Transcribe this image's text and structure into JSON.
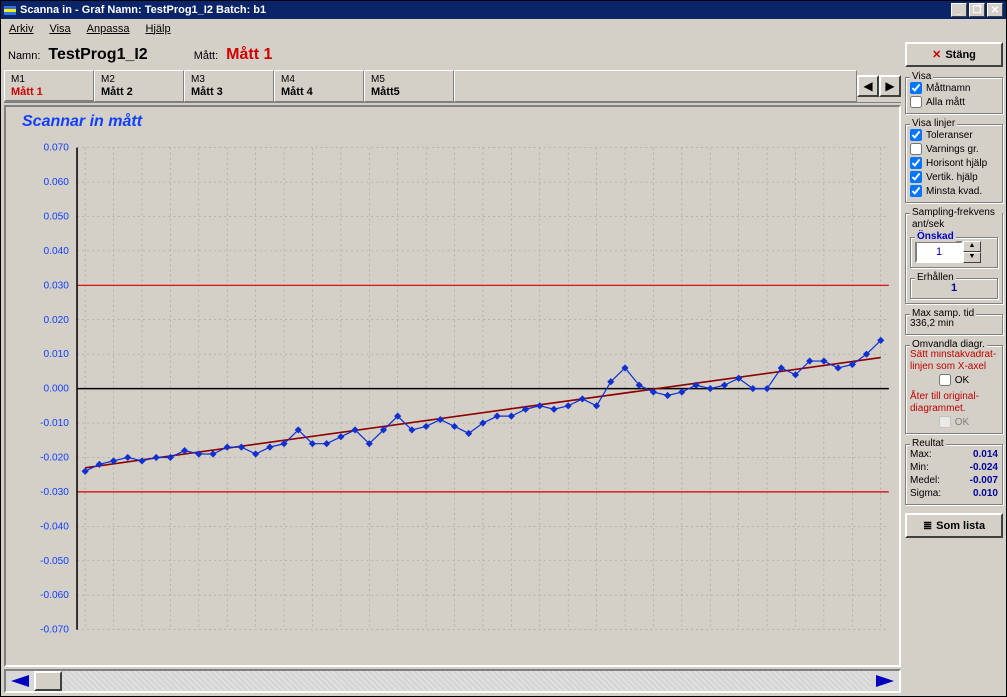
{
  "titlebar": "Scanna in - Graf   Namn: TestProg1_I2   Batch: b1",
  "menu": {
    "arkiv": "Arkiv",
    "visa": "Visa",
    "anpassa": "Anpassa",
    "hjalp": "Hjälp"
  },
  "header": {
    "namn_lbl": "Namn:",
    "namn": "TestProg1_I2",
    "matt_lbl": "Mått:",
    "matt": "Mått 1"
  },
  "tabs": [
    {
      "m": "M1",
      "name": "Mått 1",
      "active": true
    },
    {
      "m": "M2",
      "name": "Mått 2"
    },
    {
      "m": "M3",
      "name": "Mått 3"
    },
    {
      "m": "M4",
      "name": "Mått 4"
    },
    {
      "m": "M5",
      "name": "Mått5"
    }
  ],
  "chart_title": "Scannar in mått",
  "right": {
    "close": "Stäng",
    "visa_lbl": "Visa",
    "mattnamn": "Måttnamn",
    "allamatt": "Alla mått",
    "visalinjer_lbl": "Visa linjer",
    "toleranser": "Toleranser",
    "varning": "Varnings gr.",
    "horis": "Horisont hjälp",
    "vert": "Vertik. hjälp",
    "minsta": "Minsta kvad.",
    "samp_lbl": "Sampling-frekvens ant/sek",
    "onskad_lbl": "Önskad",
    "onskad_val": "1",
    "erh_lbl": "Erhållen",
    "erh_val": "1",
    "maxsamp_lbl": "Max samp. tid",
    "maxsamp_val": "336,2 min",
    "omv_lbl": "Omvandla diagr.",
    "omv_t1": "Sätt minstakvadrat-linjen som X-axel",
    "ok": "OK",
    "omv_t2": "Åter till original-diagrammet.",
    "res_lbl": "Reultat",
    "max_l": "Max:",
    "max_v": "0.014",
    "min_l": "Min:",
    "min_v": "-0.024",
    "medel_l": "Medel:",
    "medel_v": "-0.007",
    "sigma_l": "Sigma:",
    "sigma_v": "0.010",
    "somlista": "Som lista"
  },
  "chart_data": {
    "type": "line",
    "title": "Scannar in mått",
    "xlabel": "",
    "ylabel": "",
    "ylim": [
      -0.07,
      0.07
    ],
    "yticks": [
      -0.07,
      -0.06,
      -0.05,
      -0.04,
      -0.03,
      -0.02,
      -0.01,
      0.0,
      0.01,
      0.02,
      0.03,
      0.04,
      0.05,
      0.06,
      0.07
    ],
    "tolerance_upper": 0.03,
    "tolerance_lower": -0.03,
    "x": [
      0,
      1,
      2,
      3,
      4,
      5,
      6,
      7,
      8,
      9,
      10,
      11,
      12,
      13,
      14,
      15,
      16,
      17,
      18,
      19,
      20,
      21,
      22,
      23,
      24,
      25,
      26,
      27,
      28,
      29,
      30,
      31,
      32,
      33,
      34,
      35,
      36,
      37,
      38,
      39,
      40,
      41,
      42,
      43,
      44,
      45,
      46,
      47,
      48,
      49,
      50,
      51,
      52,
      53,
      54,
      55,
      56
    ],
    "values": [
      -0.024,
      -0.022,
      -0.021,
      -0.02,
      -0.021,
      -0.02,
      -0.02,
      -0.018,
      -0.019,
      -0.019,
      -0.017,
      -0.017,
      -0.019,
      -0.017,
      -0.016,
      -0.012,
      -0.016,
      -0.016,
      -0.014,
      -0.012,
      -0.016,
      -0.012,
      -0.008,
      -0.012,
      -0.011,
      -0.009,
      -0.011,
      -0.013,
      -0.01,
      -0.008,
      -0.008,
      -0.006,
      -0.005,
      -0.006,
      -0.005,
      -0.003,
      -0.005,
      0.002,
      0.006,
      0.001,
      -0.001,
      -0.002,
      -0.001,
      0.001,
      0.0,
      0.001,
      0.003,
      0.0,
      0.0,
      0.006,
      0.004,
      0.008,
      0.008,
      0.006,
      0.007,
      0.01,
      0.014
    ],
    "fit_line": {
      "y_start": -0.023,
      "y_end": 0.009
    }
  }
}
